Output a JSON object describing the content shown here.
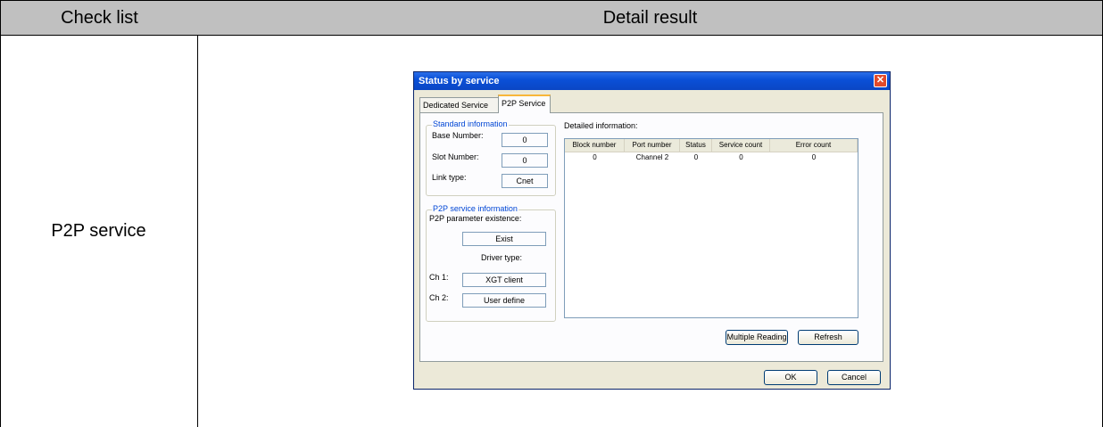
{
  "table": {
    "headers": [
      "Check list",
      "Detail result"
    ],
    "row_label": "P2P service"
  },
  "dialog": {
    "title": "Status by service",
    "close_glyph": "✕",
    "tabs": [
      "Dedicated Service",
      "P2P Service"
    ],
    "standard_info": {
      "title": "Standard information",
      "base_label": "Base Number:",
      "base_value": "0",
      "slot_label": "Slot Number:",
      "slot_value": "0",
      "link_label": "Link type:",
      "link_value": "Cnet"
    },
    "p2p_info": {
      "title": "P2P service information",
      "existence_label": "P2P parameter existence:",
      "existence_value": "Exist",
      "driver_label": "Driver type:",
      "ch1_label": "Ch 1:",
      "ch1_value": "XGT client",
      "ch2_label": "Ch 2:",
      "ch2_value": "User define"
    },
    "detailed": {
      "title": "Detailed information:",
      "columns": [
        "Block number",
        "Port number",
        "Status",
        "Service count",
        "Error count"
      ],
      "rows": [
        [
          "0",
          "Channel 2",
          "0",
          "0",
          "0"
        ]
      ]
    },
    "buttons": {
      "multiple_reading": "Multiple Reading",
      "refresh": "Refresh",
      "ok": "OK",
      "cancel": "Cancel"
    }
  }
}
